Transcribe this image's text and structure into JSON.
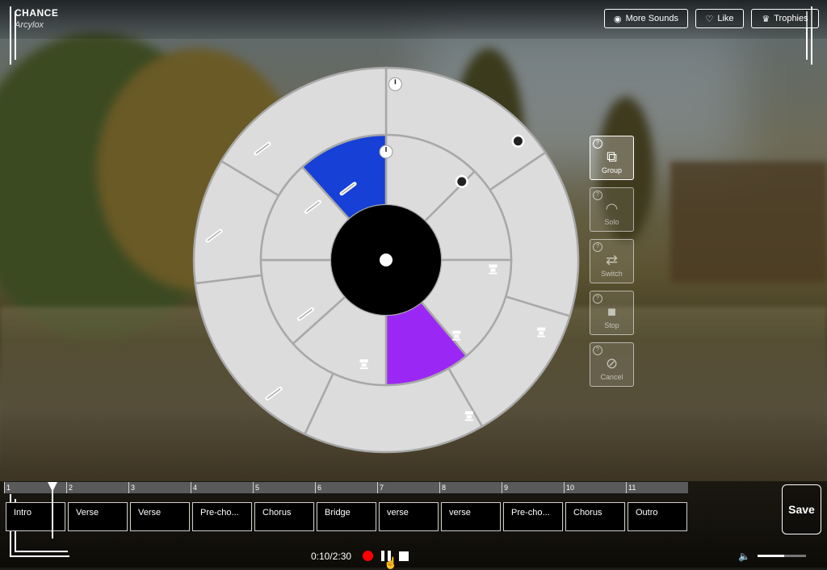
{
  "app": {
    "title": "CHANCE",
    "artist": "Arcylox"
  },
  "top_buttons": [
    {
      "label": "More Sounds",
      "icon": "record-icon"
    },
    {
      "label": "Like",
      "icon": "heart-icon"
    },
    {
      "label": "Trophies",
      "icon": "trophy-icon"
    }
  ],
  "side_buttons": [
    {
      "label": "Group",
      "icon": "group-icon",
      "active": true
    },
    {
      "label": "Solo",
      "icon": "headphones-icon",
      "active": false
    },
    {
      "label": "Switch",
      "icon": "switch-icon",
      "active": false
    },
    {
      "label": "Stop",
      "icon": "stop-icon",
      "active": false
    },
    {
      "label": "Cancel",
      "icon": "cancel-icon",
      "active": false
    }
  ],
  "wheel": {
    "colors": {
      "segment": "#dcdcdc",
      "border": "#a8a8a8",
      "hub": "#000000",
      "blue": "#1640d6",
      "purple": "#9b27f5"
    }
  },
  "timeline": {
    "markers": [
      "1",
      "2",
      "3",
      "4",
      "5",
      "6",
      "7",
      "8",
      "9",
      "10",
      "11"
    ],
    "sections": [
      "Intro",
      "Verse",
      "Verse",
      "Pre-cho...",
      "Chorus",
      "Bridge",
      "verse",
      "verse",
      "Pre-cho...",
      "Chorus",
      "Outro"
    ]
  },
  "playback": {
    "time": "0:10/2:30",
    "volume_fraction": 0.55,
    "colors": {
      "record": "#ff0000"
    }
  },
  "save_label": "Save"
}
